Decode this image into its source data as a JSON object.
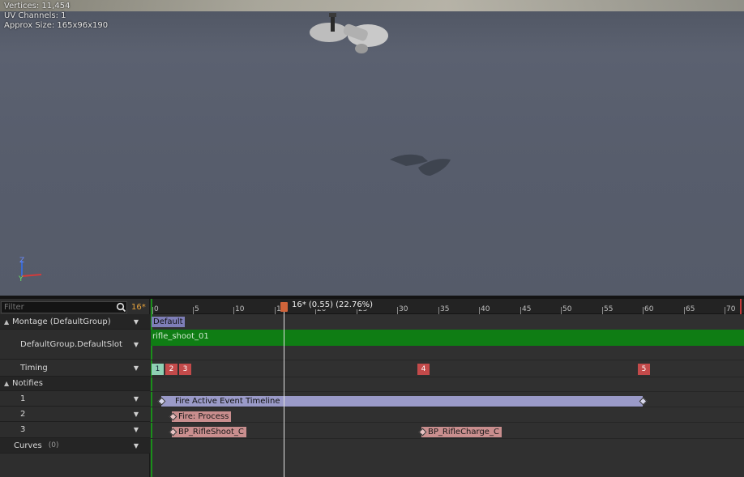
{
  "viewport": {
    "stats": [
      "Vertices: 11,454",
      "UV Channels: 1",
      "Approx Size: 165x96x190"
    ],
    "axis": {
      "z": "Z",
      "y": "Y"
    },
    "colors": {
      "x_axis": "#d33b3b",
      "y_axis": "#3bd35b",
      "z_axis": "#3b6bd3"
    }
  },
  "filter": {
    "placeholder": "Filter",
    "frame": "16*"
  },
  "tree": {
    "montage": "Montage (DefaultGroup)",
    "slot": "DefaultGroup.DefaultSlot",
    "timing": "Timing",
    "notifies": "Notifies",
    "notify_tracks": [
      "1",
      "2",
      "3"
    ],
    "curves": "Curves",
    "curves_count": "(0)"
  },
  "timeline": {
    "playhead_label": "16* (0.55) (22.76%)",
    "ruler_labels": [
      "0",
      "5",
      "10",
      "15",
      "20",
      "25",
      "30",
      "35",
      "40",
      "45",
      "50",
      "55",
      "60",
      "65",
      "70"
    ],
    "group_name": "Default",
    "slot_anim": "rifle_shoot_01",
    "sections": [
      "1",
      "2",
      "3",
      "4",
      "5"
    ],
    "notify_state": "Fire Active Event Timeline",
    "notify_process": "Fire: Process",
    "notify_shoot": "BP_RifleShoot_C",
    "notify_charge": "BP_RifleCharge_C"
  }
}
